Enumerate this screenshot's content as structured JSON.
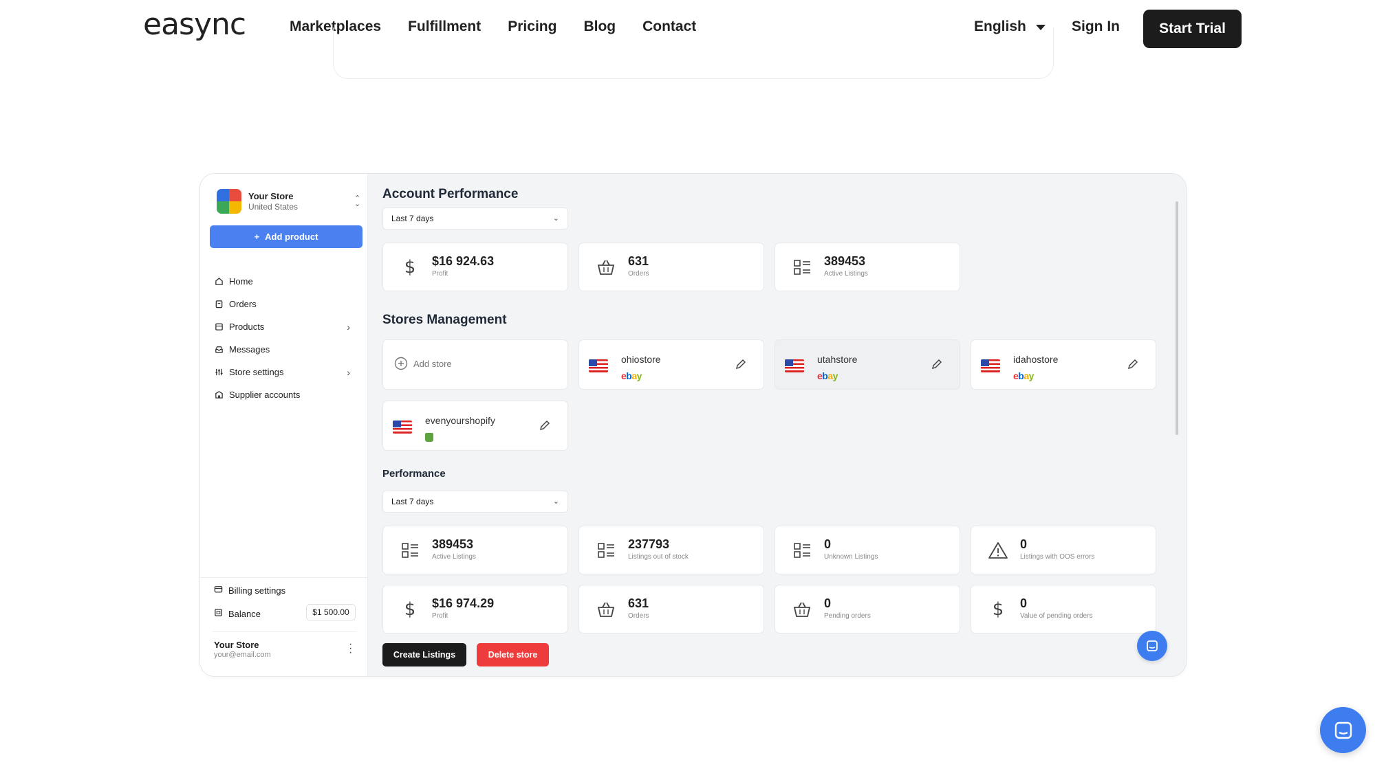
{
  "nav": {
    "logo": "easync",
    "links": [
      "Marketplaces",
      "Fulfillment",
      "Pricing",
      "Blog",
      "Contact"
    ],
    "language": "English",
    "sign_in": "Sign In",
    "start_trial": "Start Trial"
  },
  "sidebar": {
    "store_name": "Your Store",
    "store_country": "United States",
    "add_product": "Add product",
    "items": [
      {
        "label": "Home",
        "icon": "home-icon",
        "chevron": false
      },
      {
        "label": "Orders",
        "icon": "clipboard-icon",
        "chevron": false
      },
      {
        "label": "Products",
        "icon": "box-icon",
        "chevron": true
      },
      {
        "label": "Messages",
        "icon": "inbox-icon",
        "chevron": false
      },
      {
        "label": "Store settings",
        "icon": "sliders-icon",
        "chevron": true
      },
      {
        "label": "Supplier accounts",
        "icon": "building-icon",
        "chevron": false
      }
    ],
    "billing": "Billing settings",
    "balance_label": "Balance",
    "balance_value": "$1 500.00",
    "user_name": "Your Store",
    "user_email": "your@email.com"
  },
  "account_performance": {
    "title": "Account Performance",
    "period": "Last 7 days",
    "cards": [
      {
        "value": "$16 924.63",
        "label": "Profit",
        "icon": "dollar-icon"
      },
      {
        "value": "631",
        "label": "Orders",
        "icon": "basket-icon"
      },
      {
        "value": "389453",
        "label": "Active Listings",
        "icon": "list-icon"
      }
    ]
  },
  "stores": {
    "title": "Stores Management",
    "add_store": "Add store",
    "items": [
      {
        "name": "ohiostore",
        "platform": "ebay"
      },
      {
        "name": "utahstore",
        "platform": "ebay"
      },
      {
        "name": "idahostore",
        "platform": "ebay"
      },
      {
        "name": "evenyourshopify",
        "platform": "shopify"
      }
    ]
  },
  "performance": {
    "title": "Performance",
    "period": "Last 7 days",
    "row1": [
      {
        "value": "389453",
        "label": "Active Listings",
        "icon": "list-icon"
      },
      {
        "value": "237793",
        "label": "Listings out of stock",
        "icon": "list-icon"
      },
      {
        "value": "0",
        "label": "Unknown Listings",
        "icon": "list-icon"
      },
      {
        "value": "0",
        "label": "Listings with OOS errors",
        "icon": "warning-icon"
      }
    ],
    "row2": [
      {
        "value": "$16 974.29",
        "label": "Profit",
        "icon": "dollar-icon"
      },
      {
        "value": "631",
        "label": "Orders",
        "icon": "basket-icon"
      },
      {
        "value": "0",
        "label": "Pending orders",
        "icon": "basket-icon"
      },
      {
        "value": "0",
        "label": "Value of pending orders",
        "icon": "dollar-icon"
      }
    ],
    "create_listings": "Create Listings",
    "delete_store": "Delete store"
  },
  "colors": {
    "accent": "#4a80f0",
    "danger": "#ee3b3b",
    "dark": "#1c1c1c"
  }
}
